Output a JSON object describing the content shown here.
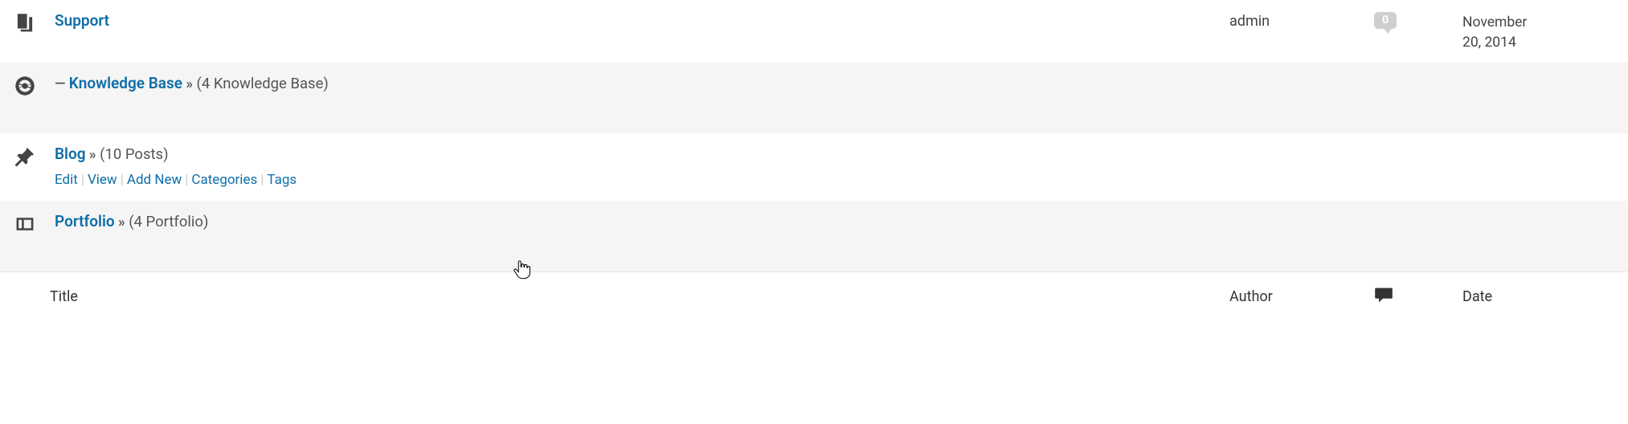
{
  "rows": [
    {
      "icon": "pages-icon",
      "prefix": "",
      "title": "Support",
      "arrow": "",
      "count_text": "",
      "author": "admin",
      "comments": "0",
      "date_line1": "November",
      "date_line2": "20, 2014",
      "actions": []
    },
    {
      "icon": "help-icon",
      "prefix": "— ",
      "title": "Knowledge Base",
      "arrow": " »",
      "count_text": " (4 Knowledge Base)",
      "author": "",
      "comments": "",
      "date_line1": "",
      "date_line2": "",
      "actions": []
    },
    {
      "icon": "pin-icon",
      "prefix": "",
      "title": "Blog",
      "arrow": " »",
      "count_text": " (10 Posts)",
      "author": "",
      "comments": "",
      "date_line1": "",
      "date_line2": "",
      "actions": [
        "Edit",
        "View",
        "Add New",
        "Categories",
        "Tags"
      ]
    },
    {
      "icon": "portfolio-icon",
      "prefix": "",
      "title": "Portfolio",
      "arrow": " »",
      "count_text": " (4 Portfolio)",
      "author": "",
      "comments": "",
      "date_line1": "",
      "date_line2": "",
      "actions": []
    }
  ],
  "footer": {
    "title": "Title",
    "author": "Author",
    "date": "Date"
  }
}
